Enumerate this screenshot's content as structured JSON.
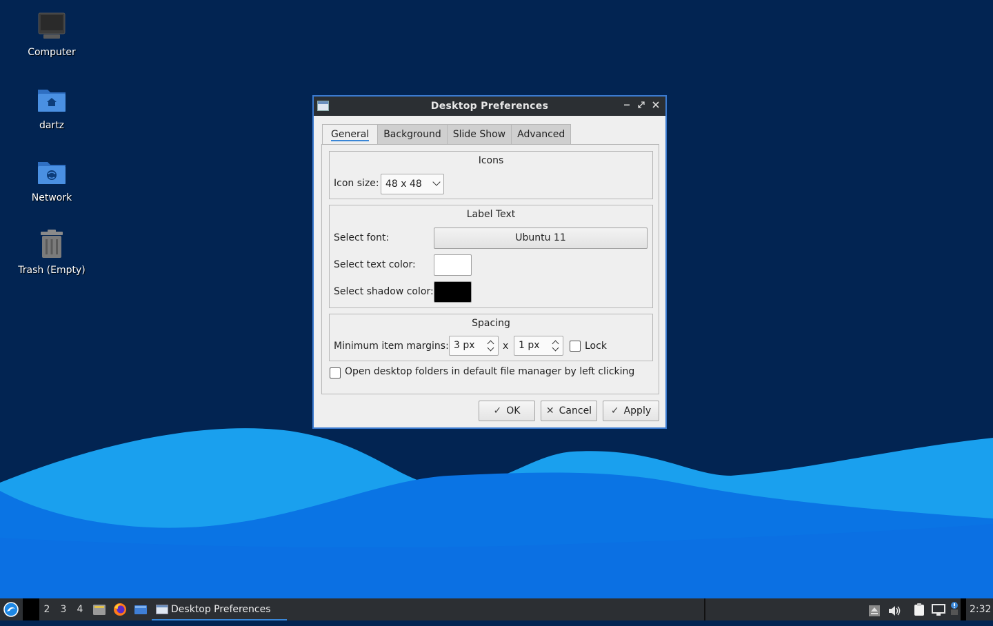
{
  "desktop": {
    "icons": [
      {
        "label": "Computer",
        "icon": "computer-icon"
      },
      {
        "label": "dartz",
        "icon": "home-folder-icon"
      },
      {
        "label": "Network",
        "icon": "network-folder-icon"
      },
      {
        "label": "Trash (Empty)",
        "icon": "trash-icon"
      }
    ]
  },
  "window": {
    "title": "Desktop Preferences",
    "tabs": [
      "General",
      "Background",
      "Slide Show",
      "Advanced"
    ],
    "active_tab": "General",
    "icons_group": {
      "title": "Icons",
      "icon_size_label": "Icon size:",
      "icon_size_value": "48 x 48"
    },
    "label_text_group": {
      "title": "Label Text",
      "font_label": "Select font:",
      "font_value": "Ubuntu 11",
      "text_color_label": "Select text color:",
      "text_color": "#ffffff",
      "shadow_color_label": "Select shadow color:",
      "shadow_color": "#000000"
    },
    "spacing_group": {
      "title": "Spacing",
      "margins_label": "Minimum item margins:",
      "margin_x": "3 px",
      "separator": "x",
      "margin_y": "1 px",
      "lock_label": "Lock",
      "lock_checked": false
    },
    "open_folders_label": "Open desktop folders in default file manager by left clicking",
    "open_folders_checked": false,
    "buttons": {
      "ok": "OK",
      "cancel": "Cancel",
      "apply": "Apply"
    }
  },
  "taskbar": {
    "desktops": [
      "2",
      "3",
      "4"
    ],
    "task_title": "Desktop Preferences",
    "clock": "2:32"
  },
  "colors": {
    "desktop_bg": "#022452",
    "wave_light": "#1aa0ee",
    "wave_dark": "#0a6ee0",
    "accent": "#3a86d6"
  }
}
